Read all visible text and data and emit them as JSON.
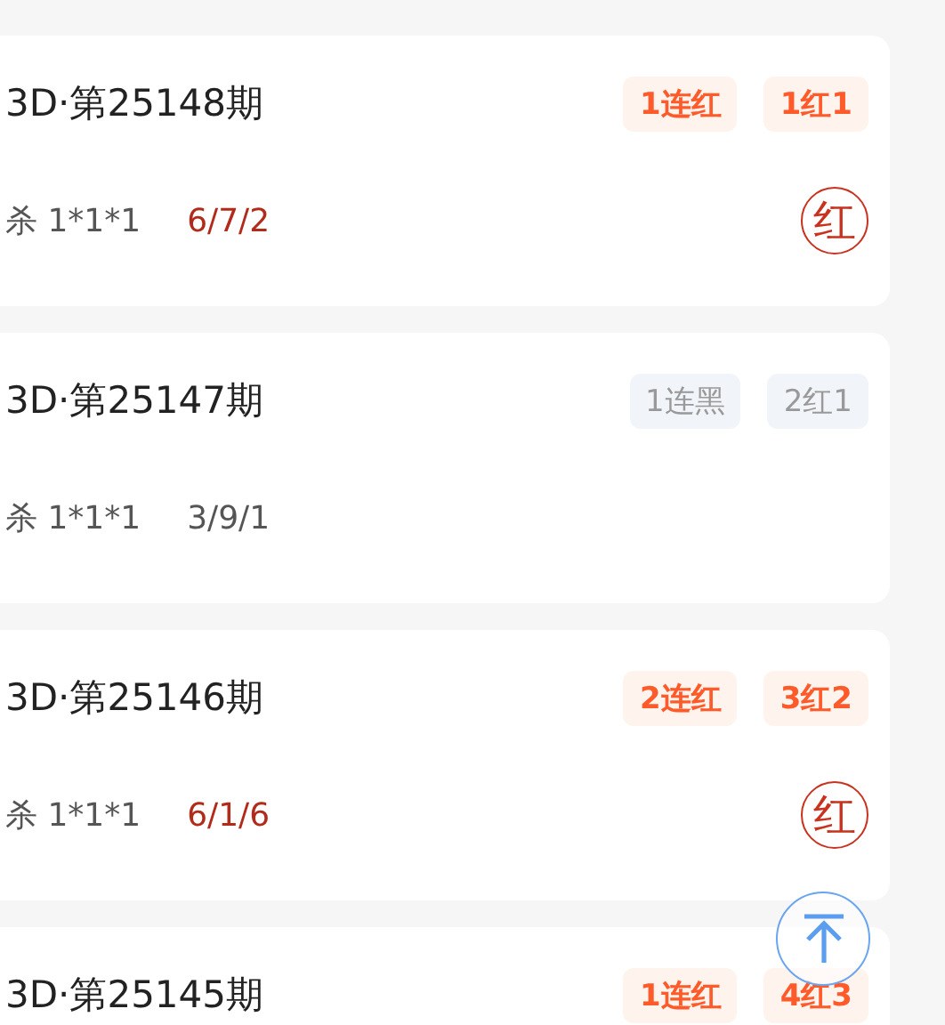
{
  "draws": [
    {
      "title": "3D·第25148期",
      "hit": true,
      "tags": [
        "1连红",
        "1红1"
      ],
      "kill": "杀 1*1*1",
      "result": "6/7/2",
      "stamp": "红"
    },
    {
      "title": "3D·第25147期",
      "hit": false,
      "tags": [
        "1连黑",
        "2红1"
      ],
      "kill": "杀 1*1*1",
      "result": "3/9/1"
    },
    {
      "title": "3D·第25146期",
      "hit": true,
      "tags": [
        "2连红",
        "3红2"
      ],
      "kill": "杀 1*1*1",
      "result": "6/1/6",
      "stamp": "红"
    },
    {
      "title": "3D·第25145期",
      "hit": true,
      "tags": [
        "1连红",
        "4红3"
      ]
    }
  ]
}
